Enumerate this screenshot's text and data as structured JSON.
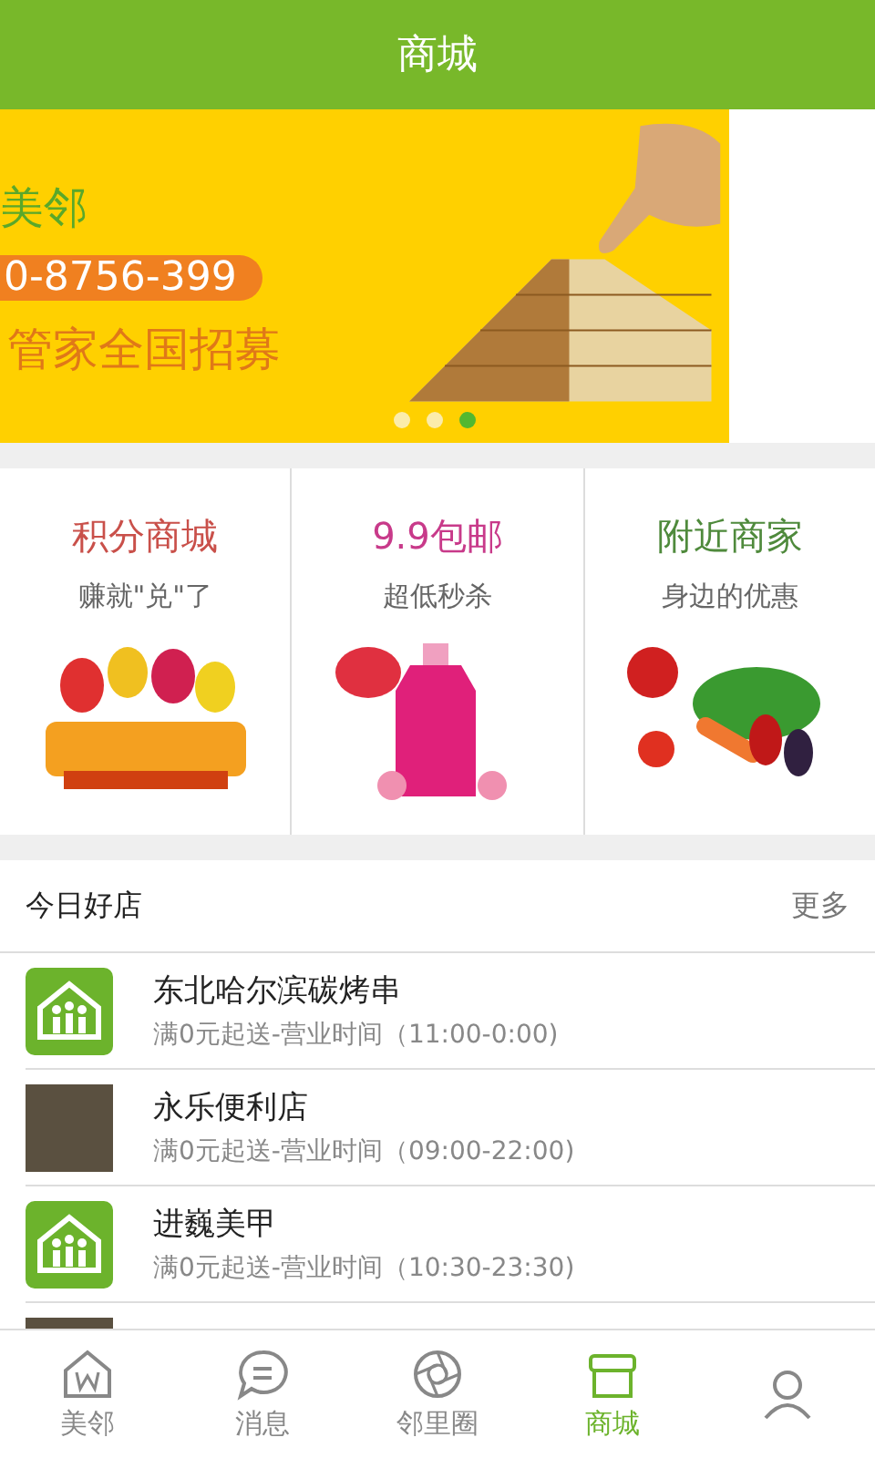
{
  "header": {
    "title": "商城"
  },
  "banner": {
    "brand": "美邻",
    "phone": "0-8756-399",
    "slogan": "管家全国招募",
    "dots": [
      {
        "selected": false
      },
      {
        "selected": false
      },
      {
        "selected": true
      }
    ]
  },
  "promos": [
    {
      "title": "积分商城",
      "subtitle": "赚就\"兑\"了",
      "color": "#c9504a",
      "kind": "gift"
    },
    {
      "title": "9.9包邮",
      "subtitle": "超低秒杀",
      "color": "#c83a8a",
      "kind": "bottle"
    },
    {
      "title": "附近商家",
      "subtitle": "身边的优惠",
      "color": "#4f8a3c",
      "kind": "veg"
    }
  ],
  "section": {
    "title": "今日好店",
    "more": "更多"
  },
  "stores": [
    {
      "kind": "logo",
      "name": "东北哈尔滨碳烤串",
      "info": "满0元起送-营业时间（11:00-0:00)"
    },
    {
      "kind": "photo",
      "name": "永乐便利店",
      "info": "满0元起送-营业时间（09:00-22:00)"
    },
    {
      "kind": "logo",
      "name": "进巍美甲",
      "info": "满0元起送-营业时间（10:30-23:30)"
    },
    {
      "kind": "photo"
    }
  ],
  "nav": [
    {
      "kind": "home",
      "label": "美邻",
      "selected": false
    },
    {
      "kind": "chat",
      "label": "消息",
      "selected": false
    },
    {
      "kind": "aperture",
      "label": "邻里圈",
      "selected": false
    },
    {
      "kind": "shop",
      "label": "商城",
      "selected": true
    },
    {
      "kind": "person",
      "selected": false
    }
  ]
}
